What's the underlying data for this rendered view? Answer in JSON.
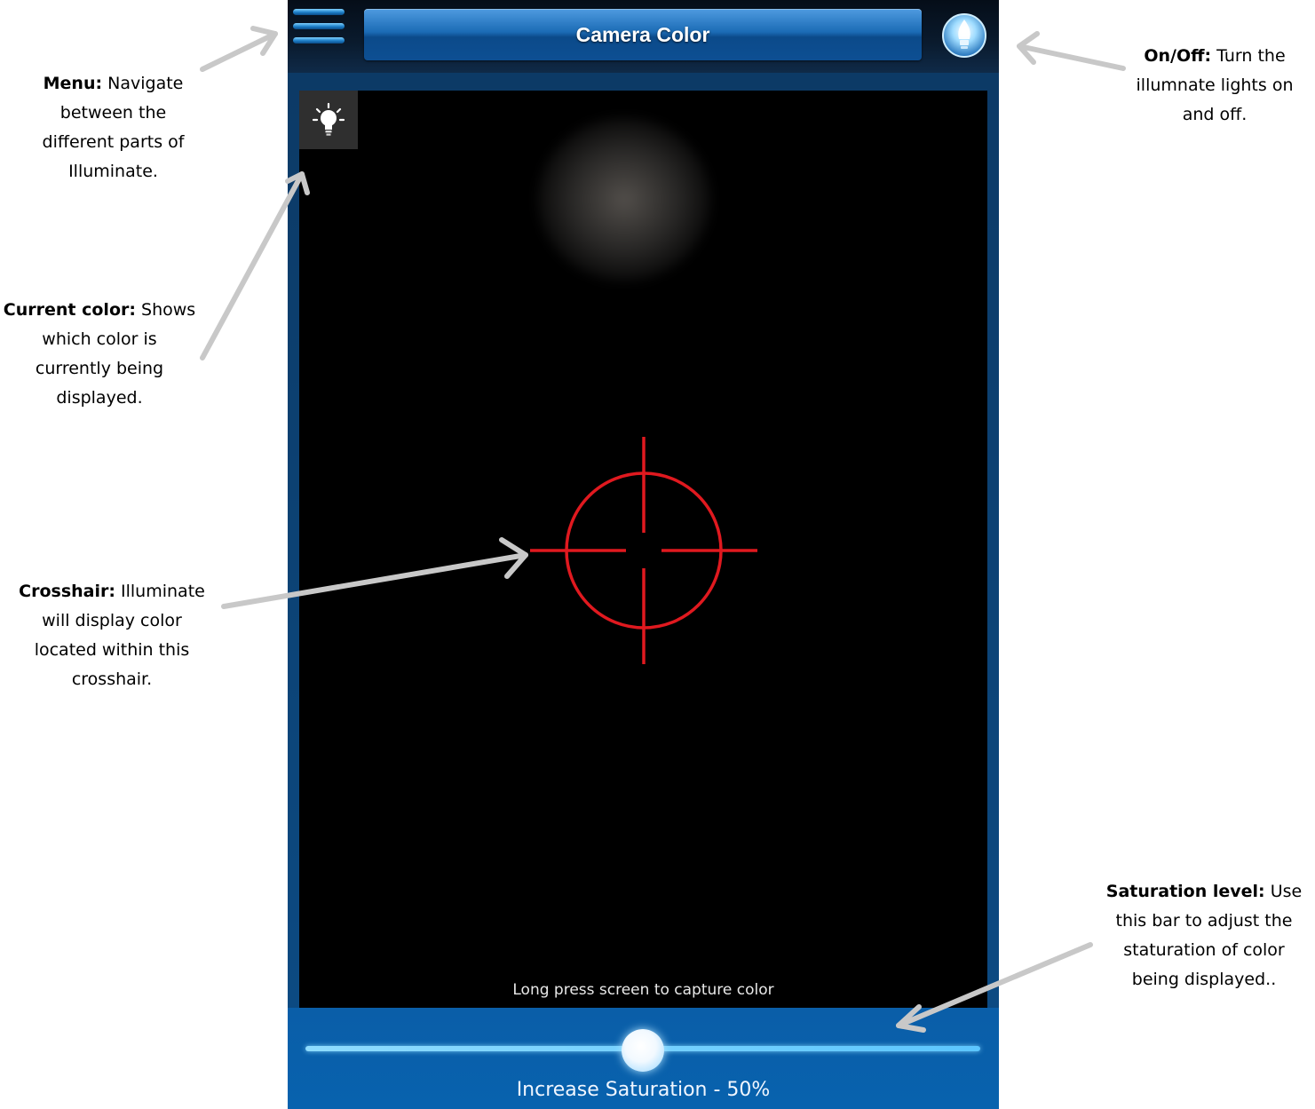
{
  "app": {
    "title": "Camera Color",
    "hint": "Long press screen to capture  color",
    "saturation_label": "Increase Saturation - 50%",
    "saturation_value": 0.5
  },
  "annotations": {
    "menu": {
      "label": "Menu:",
      "lines": [
        "Navigate",
        "between the",
        "different parts of",
        "Illuminate."
      ]
    },
    "onoff": {
      "label": "On/Off:",
      "lines": [
        "Turn the",
        "illumnate lights on",
        "and off."
      ]
    },
    "current_color": {
      "label": "Current color:",
      "lines": [
        "Shows",
        "which color is",
        "currently being",
        "displayed."
      ]
    },
    "crosshair": {
      "label": "Crosshair:",
      "lines": [
        "Illuminate",
        "will display color",
        "located within this",
        "crosshair."
      ]
    },
    "saturation": {
      "label": "Saturation level:",
      "lines": [
        "Use",
        "this bar to adjust the",
        "staturation of color",
        "being displayed.."
      ]
    }
  },
  "icons": {
    "menu": "hamburger-menu-icon",
    "power": "bulb-power-icon",
    "current_color": "lightbulb-icon"
  },
  "colors": {
    "accent": "#1b6bb5",
    "crosshair": "#e0191f",
    "background_panel": "#0862ae"
  }
}
